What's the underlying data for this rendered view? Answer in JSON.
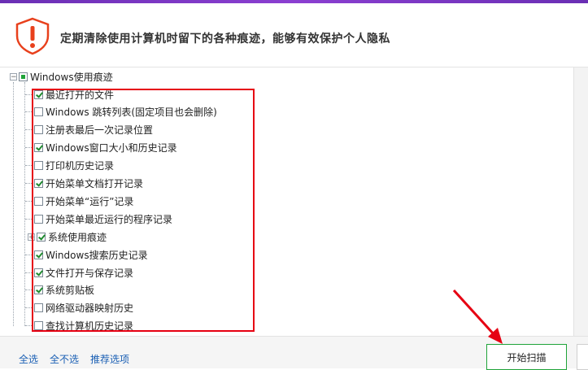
{
  "header": {
    "text": "定期清除使用计算机时留下的各种痕迹，能够有效保护个人隐私",
    "icon": "warning-icon",
    "accent": "#e8401c"
  },
  "tree": {
    "root": {
      "label": "Windows使用痕迹",
      "state": "partial"
    },
    "items": [
      {
        "label": "最近打开的文件",
        "checked": true
      },
      {
        "label": "Windows 跳转列表(固定项目也会删除)",
        "checked": false
      },
      {
        "label": "注册表最后一次记录位置",
        "checked": false
      },
      {
        "label": "Windows窗口大小和历史记录",
        "checked": true
      },
      {
        "label": "打印机历史记录",
        "checked": false
      },
      {
        "label": "开始菜单文档打开记录",
        "checked": true
      },
      {
        "label": "开始菜单“运行”记录",
        "checked": false
      },
      {
        "label": "开始菜单最近运行的程序记录",
        "checked": false
      },
      {
        "label": "系统使用痕迹",
        "checked": true,
        "expandable": true
      },
      {
        "label": "Windows搜索历史记录",
        "checked": true
      },
      {
        "label": "文件打开与保存记录",
        "checked": true
      },
      {
        "label": "系统剪贴板",
        "checked": true
      },
      {
        "label": "网络驱动器映射历史",
        "checked": false
      },
      {
        "label": "查找计算机历史记录",
        "checked": false
      }
    ]
  },
  "footer": {
    "select_all": "全选",
    "select_none": "全不选",
    "recommended": "推荐选项",
    "scan_button": "开始扫描"
  },
  "colors": {
    "highlight": "#e60012",
    "link": "#1a5fb4",
    "check": "#1e8a2e",
    "button_border": "#1fa339"
  }
}
